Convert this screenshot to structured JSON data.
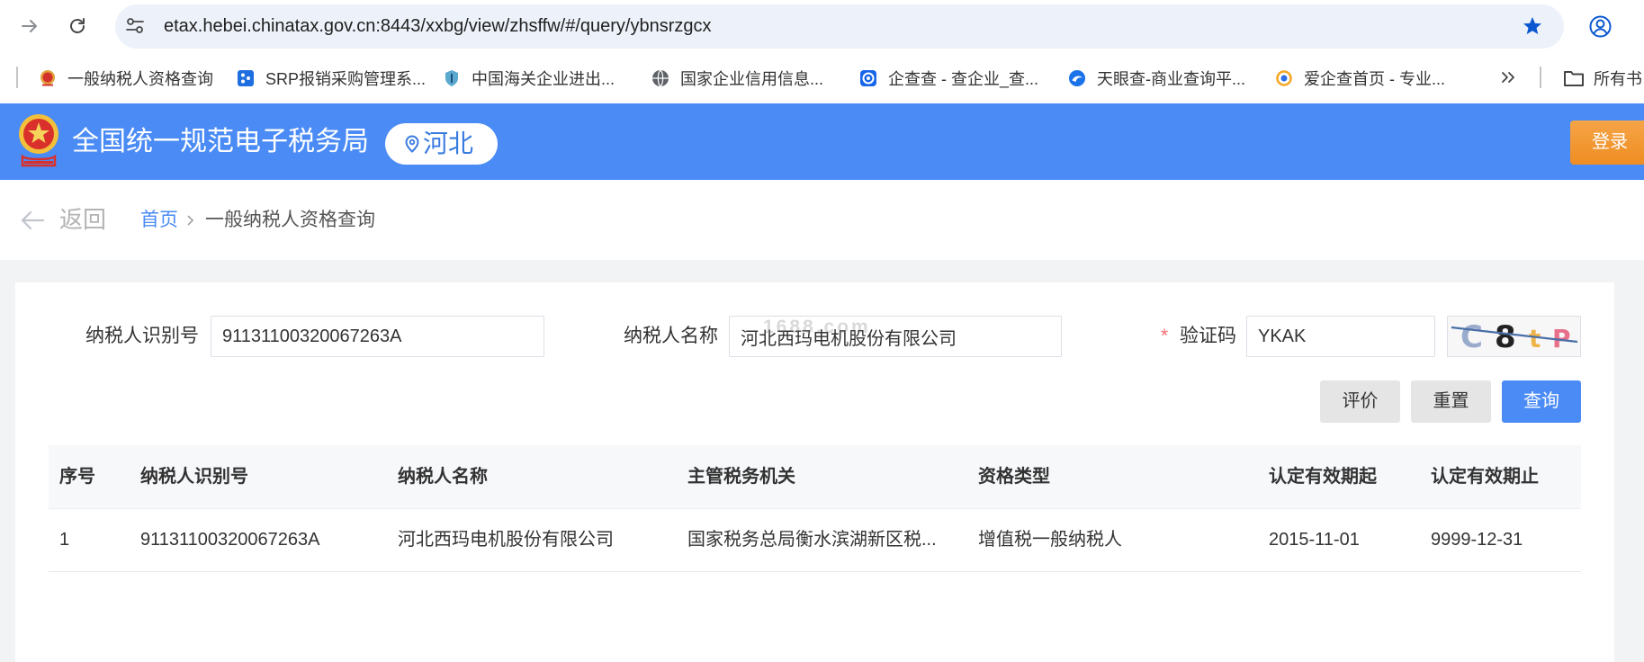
{
  "browser": {
    "url": "etax.hebei.chinatax.gov.cn:8443/xxbg/view/zhsffw/#/query/ybnsrzgcx",
    "bookmarks": [
      {
        "label": "一般纳税人资格查询",
        "icon": "tax-emblem-icon"
      },
      {
        "label": "SRP报销采购管理系...",
        "icon": "srp-app-icon"
      },
      {
        "label": "中国海关企业进出...",
        "icon": "customs-shield-icon"
      },
      {
        "label": "国家企业信用信息...",
        "icon": "globe-icon"
      },
      {
        "label": "企查查 - 查企业_查...",
        "icon": "qichacha-icon"
      },
      {
        "label": "天眼查-商业查询平...",
        "icon": "tianyancha-icon"
      },
      {
        "label": "爱企查首页 - 专业...",
        "icon": "aiqicha-icon"
      }
    ],
    "all_bookmarks_label": "所有书"
  },
  "header": {
    "title": "全国统一规范电子税务局",
    "region": "河北",
    "login_label": "登录"
  },
  "breadcrumb": {
    "back_label": "返回",
    "home": "首页",
    "current": "一般纳税人资格查询"
  },
  "form": {
    "taxpayer_id": {
      "label": "纳税人识别号",
      "value": "91131100320067263A"
    },
    "taxpayer_name": {
      "label": "纳税人名称",
      "value": "河北西玛电机股份有限公司"
    },
    "captcha": {
      "required_mark": "*",
      "label": "验证码",
      "value": "YKAK",
      "image_chars": [
        "C",
        "8",
        "t",
        "P"
      ]
    },
    "watermark": "1688.com"
  },
  "actions": {
    "evaluate": "评价",
    "reset": "重置",
    "query": "查询"
  },
  "table": {
    "columns": [
      "序号",
      "纳税人识别号",
      "纳税人名称",
      "主管税务机关",
      "资格类型",
      "认定有效期起",
      "认定有效期止"
    ],
    "rows": [
      [
        "1",
        "91131100320067263A",
        "河北西玛电机股份有限公司",
        "国家税务总局衡水滨湖新区税...",
        "增值税一般纳税人",
        "2015-11-01",
        "9999-12-31"
      ]
    ]
  },
  "icons": [
    "forward-arrow-icon",
    "reload-icon",
    "site-settings-icon",
    "bookmark-star-icon",
    "profile-icon",
    "double-chevron-icon",
    "folder-icon",
    "tax-emblem-logo",
    "location-pin-icon",
    "back-arrow-icon",
    "chevron-right-icon"
  ],
  "theme": {
    "primary": "#4a8bf5",
    "accent_orange": "#f39a34",
    "required_red": "#f56c6c",
    "page_bg": "#f2f3f5"
  }
}
